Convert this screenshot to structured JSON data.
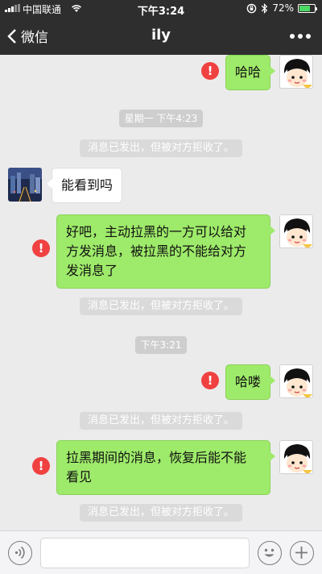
{
  "status_bar": {
    "carrier": "中国联通",
    "time": "下午3:24",
    "battery": "72%",
    "battery_level": 0.72
  },
  "nav": {
    "back_label": "微信",
    "title": "ily"
  },
  "messages": {
    "m1": "哈哈",
    "stamp1": "星期一 下午4:23",
    "sys1": "消息已发出，但被对方拒收了。",
    "m2": "能看到吗",
    "m3_line1": "好吧，主动拉黑的一方可以给对",
    "m3_line2": "方发消息，被拉黑的不能给对方",
    "m3_line3": "发消息了",
    "sys2": "消息已发出，但被对方拒收了。",
    "stamp2": "下午3:21",
    "m4": "哈喽",
    "sys3": "消息已发出，但被对方拒收了。",
    "m5_line1": "拉黑期间的消息，恢复后能不能",
    "m5_line2": "看见",
    "sys4": "消息已发出，但被对方拒收了。"
  },
  "error_mark": "!",
  "colors": {
    "nav_bg": "#2e2e2e",
    "chat_bg": "#ebebeb",
    "my_bubble": "#9eea6a",
    "error_red": "#f04141"
  }
}
